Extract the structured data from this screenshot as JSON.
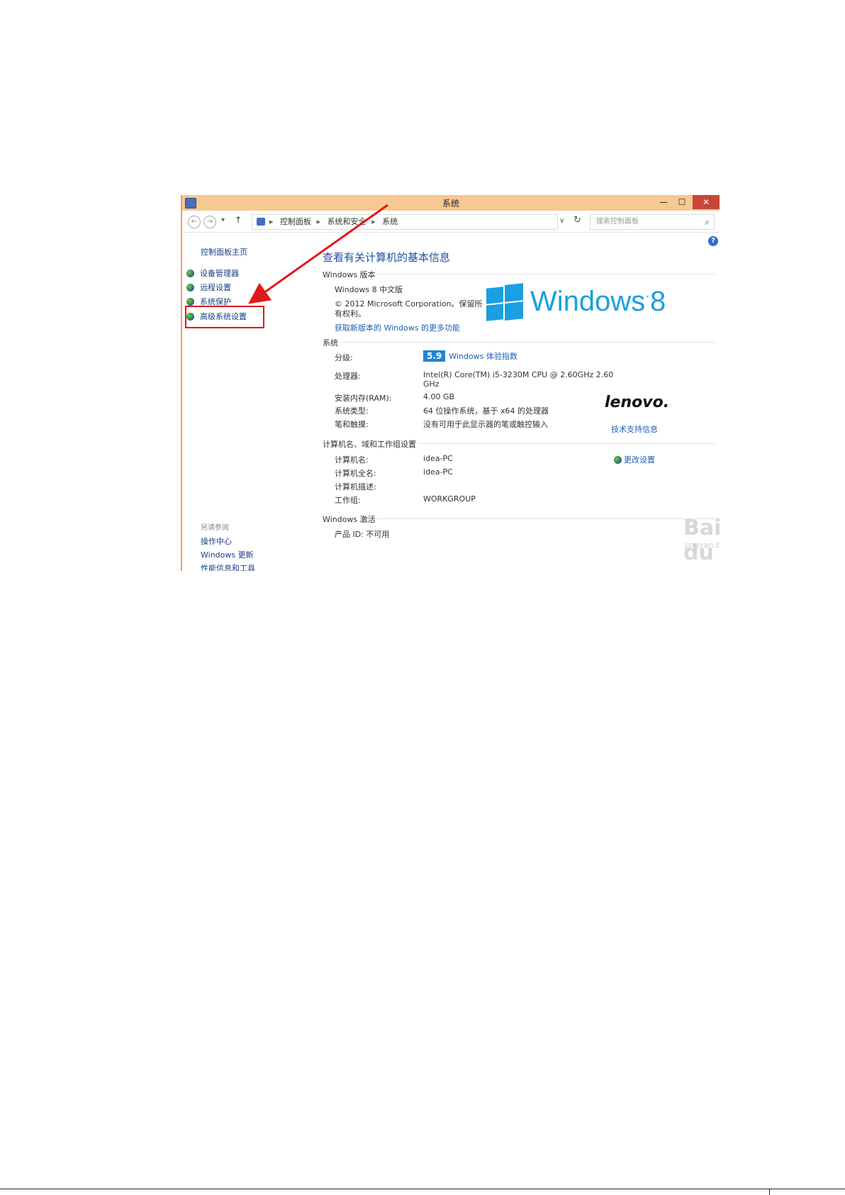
{
  "window": {
    "title": "系统",
    "minimize": "—",
    "maximize": "☐",
    "close": "✕"
  },
  "address": {
    "crumbs": [
      "控制面板",
      "系统和安全",
      "系统"
    ],
    "separator": "▸",
    "search_placeholder": "搜索控制面板"
  },
  "sidebar": {
    "home": "控制面板主页",
    "items": [
      "设备管理器",
      "远程设置",
      "系统保护",
      "高级系统设置"
    ],
    "see_also": "另请参阅",
    "see_also_links": [
      "操作中心",
      "Windows 更新",
      "性能信息和工具"
    ]
  },
  "main": {
    "page_title": "查看有关计算机的基本信息",
    "edition": {
      "heading": "Windows 版本",
      "name": "Windows 8 中文版",
      "copyright_line1": "© 2012 Microsoft Corporation。保留所",
      "copyright_line2": "有权利。",
      "more_features": "获取新版本的 Windows 的更多功能"
    },
    "system": {
      "heading": "系统",
      "rating_label": "分级:",
      "rating_value": "5.9",
      "rating_link": "Windows 体验指数",
      "processor_label": "处理器:",
      "processor_line1": "Intel(R) Core(TM) i5-3230M CPU @ 2.60GHz   2.60",
      "processor_line2": "GHz",
      "ram_label": "安装内存(RAM):",
      "ram_value": "4.00 GB",
      "type_label": "系统类型:",
      "type_value": "64 位操作系统，基于 x64 的处理器",
      "pen_label": "笔和触摸:",
      "pen_value": "没有可用于此显示器的笔或触控输入",
      "support_link": "技术支持信息"
    },
    "computer": {
      "heading": "计算机名、域和工作组设置",
      "name_label": "计算机名:",
      "name_value": "idea-PC",
      "fullname_label": "计算机全名:",
      "fullname_value": "idea-PC",
      "desc_label": "计算机描述:",
      "workgroup_label": "工作组:",
      "workgroup_value": "WORKGROUP",
      "change_link": "更改设置"
    },
    "activation": {
      "heading": "Windows 激活",
      "product_id": "产品 ID: 不可用"
    },
    "logo_text": "Windows",
    "logo_version": "8",
    "oem_logo": "lenovo.",
    "watermark": "Bai du 经验",
    "watermark_sub": "jingyan.baidu.com"
  },
  "colors": {
    "titlebar": "#f6c892",
    "close_button": "#c9453a",
    "link": "#1a5fb4",
    "windows_blue": "#1a9fe0",
    "highlight": "#e01a1a"
  }
}
